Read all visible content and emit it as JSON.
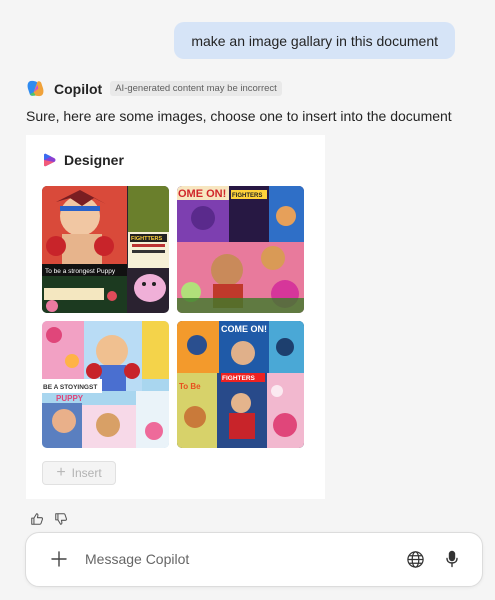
{
  "user_message": "make an image gallary in this document",
  "copilot": {
    "name": "Copilot",
    "badge": "AI-generated content may be incorrect",
    "reply": "Sure, here are some images, choose one to insert into the document"
  },
  "designer": {
    "title": "Designer",
    "insert_label": "Insert",
    "images": [
      {
        "caption_top": "FIGHTTERS",
        "caption_bottom": "To be a strongest Puppy"
      },
      {
        "caption_top": "OME ON!",
        "caption_bottom": "FIGHTERS"
      },
      {
        "caption_top": "BE A STOYINGST",
        "caption_bottom": "PUPPY"
      },
      {
        "caption_top": "COME ON!",
        "caption_bottom": "FIGHTERS"
      }
    ]
  },
  "composer": {
    "placeholder": "Message Copilot"
  },
  "icons": {
    "copilot_logo": "copilot-logo-icon",
    "designer_logo": "designer-logo-icon",
    "thumbs_up": "thumbs-up-icon",
    "thumbs_down": "thumbs-down-icon",
    "add": "plus-icon",
    "globe": "globe-icon",
    "mic": "microphone-icon"
  },
  "colors": {
    "user_bubble": "#d6e4f7",
    "background": "#f5f5f5",
    "card": "#ffffff"
  }
}
